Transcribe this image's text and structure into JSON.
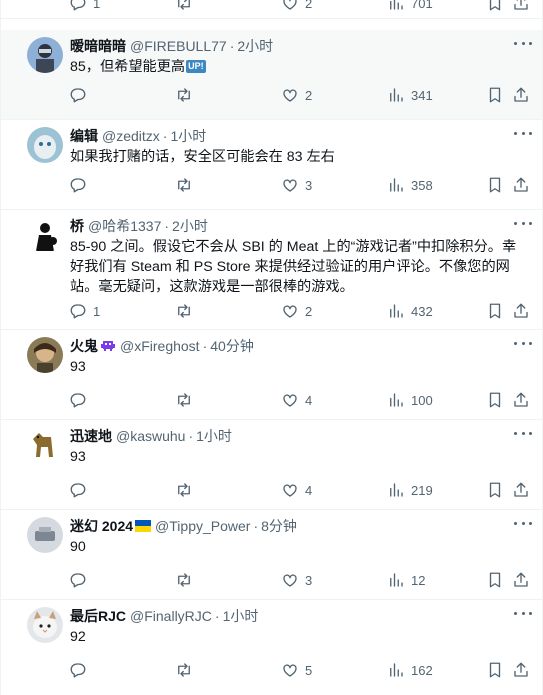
{
  "top_partial": {
    "reply": "1",
    "retweet": "",
    "like": "2",
    "views": "701"
  },
  "tweets": [
    {
      "name": "暧暗暗暗",
      "handle": "@FIREBULL77",
      "time": "2小时",
      "text": "85，但希望能更高",
      "text_badge": "UP!",
      "reply": "",
      "retweet": "",
      "like": "2",
      "views": "341",
      "avatar_color": "#6b8bb5",
      "highlight": true
    },
    {
      "name": "编辑",
      "handle": "@zeditzx",
      "time": "1小时",
      "text": "如果我打赌的话，安全区可能会在 83 左右",
      "reply": "",
      "retweet": "",
      "like": "3",
      "views": "358",
      "avatar_color": "#7fa7b8"
    },
    {
      "name": "桥",
      "handle": "@哈希1337",
      "time": "2小时",
      "text": "85-90 之间。假设它不会从 SBI 的 Meat 上的“游戏记者”中扣除积分。幸好我们有 Steam 和 PS Store 来提供经过验证的用户评论。不像您的网站。毫无疑问，这款游戏是一部很棒的游戏。",
      "reply": "1",
      "retweet": "",
      "like": "2",
      "views": "432",
      "avatar_color": "#222222"
    },
    {
      "name": "火鬼",
      "handle": "@xFireghost",
      "time": "40分钟",
      "text": "93",
      "reply": "",
      "retweet": "",
      "like": "4",
      "views": "100",
      "avatar_color": "#6a5a3a",
      "name_emoji": "alien-monster"
    },
    {
      "name": "迅速地",
      "handle": "@kaswuhu",
      "time": "1小时",
      "text": "93",
      "reply": "",
      "retweet": "",
      "like": "4",
      "views": "219",
      "avatar_color": "#8b6b2e"
    },
    {
      "name": "迷幻 2024",
      "handle": "@Tippy_Power",
      "time": "8分钟",
      "text": "90",
      "reply": "",
      "retweet": "",
      "like": "3",
      "views": "12",
      "avatar_color": "#c8cdd4",
      "name_emoji": "ukraine-flag"
    },
    {
      "name": "最后RJC",
      "handle": "@FinallyRJC",
      "time": "1小时",
      "text": "92",
      "reply": "",
      "retweet": "",
      "like": "5",
      "views": "162",
      "avatar_color": "#d9dde0"
    }
  ],
  "icons": {
    "reply": "reply-icon",
    "retweet": "retweet-icon",
    "like": "heart-icon",
    "views": "views-icon",
    "bookmark": "bookmark-icon",
    "share": "share-icon",
    "more": "more-icon"
  },
  "colors": {
    "text": "#0f1419",
    "secondary": "#536471",
    "border": "#eff3f4",
    "highlight_bg": "#f7f9f9"
  }
}
